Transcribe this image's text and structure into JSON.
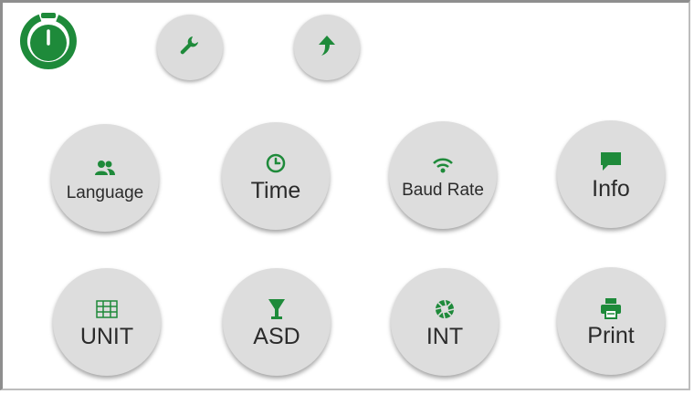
{
  "header": {
    "logo_icon": "dial-logo-icon",
    "buttons": [
      {
        "icon": "wrench-icon"
      },
      {
        "icon": "up-arrow-icon"
      }
    ]
  },
  "menu": {
    "items": [
      {
        "label": "Language",
        "icon": "users-icon"
      },
      {
        "label": "Time",
        "icon": "clock-icon"
      },
      {
        "label": "Baud Rate",
        "icon": "wifi-icon"
      },
      {
        "label": "Info",
        "icon": "chat-icon"
      },
      {
        "label": "UNIT",
        "icon": "grid-icon"
      },
      {
        "label": "ASD",
        "icon": "glass-icon"
      },
      {
        "label": "INT",
        "icon": "aperture-icon"
      },
      {
        "label": "Print",
        "icon": "printer-icon"
      }
    ]
  },
  "colors": {
    "accent": "#1e8a3a",
    "button_fill": "#dddddd",
    "text": "#2b2b2b"
  }
}
